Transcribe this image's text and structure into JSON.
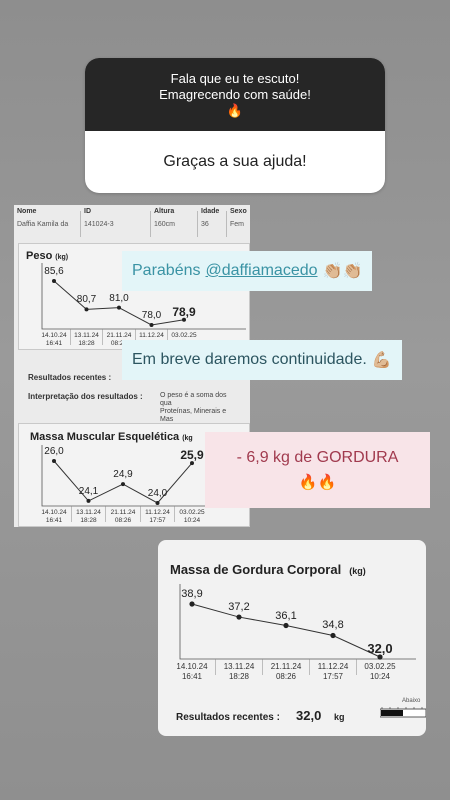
{
  "question_sticker": {
    "question_lines": [
      "Fala que eu te escuto!",
      "Emagrecendo com saúde!",
      "🔥"
    ],
    "answer": "Graças a sua ajuda!"
  },
  "report": {
    "header": [
      {
        "label": "Nome",
        "value": "Daffia Kamila da"
      },
      {
        "label": "ID",
        "value": "141024-3"
      },
      {
        "label": "Altura",
        "value": "160cm"
      },
      {
        "label": "Idade",
        "value": "36"
      },
      {
        "label": "Sexo",
        "value": "Fem"
      }
    ],
    "resultados_recentes": "Resultados recentes :",
    "interpretacao": "Interpretação dos resultados :",
    "interpretacao_texto": [
      "O peso é a soma dos qua",
      "Proteínas, Minerais e Mas"
    ]
  },
  "chart_data": [
    {
      "type": "line",
      "title": "Peso",
      "unit": "(kg)",
      "x": [
        "14.10.24 16:41",
        "13.11.24 18:28",
        "21.11.24 08:26",
        "11.12.24 17:57",
        "03.02.25 10:24"
      ],
      "values": [
        85.6,
        80.7,
        81.0,
        78.0,
        78.9
      ],
      "value_labels": [
        "85,6",
        "80,7",
        "81,0",
        "78,0",
        "78,9"
      ]
    },
    {
      "type": "line",
      "title": "Massa Muscular Esquelética",
      "unit": "(kg",
      "x": [
        "14.10.24 16:41",
        "13.11.24 18:28",
        "21.11.24 08:26",
        "11.12.24 17:57",
        "03.02.25 10:24"
      ],
      "values": [
        26.0,
        24.1,
        24.9,
        24.0,
        25.9
      ],
      "value_labels": [
        "26,0",
        "24,1",
        "24,9",
        "24,0",
        "25,9"
      ]
    },
    {
      "type": "line",
      "title": "Massa de Gordura Corporal",
      "unit": "(kg)",
      "x": [
        "14.10.24 16:41",
        "13.11.24 18:28",
        "21.11.24 08:26",
        "11.12.24 17:57",
        "03.02.25 10:24"
      ],
      "values": [
        38.9,
        37.2,
        36.1,
        34.8,
        32.0
      ],
      "value_labels": [
        "38,9",
        "37,2",
        "36,1",
        "34,8",
        "32,0"
      ]
    }
  ],
  "fat_photo": {
    "resultados_label": "Resultados recentes :",
    "resultados_value": "32,0",
    "resultados_unit": "kg",
    "scale_label": "Abaixo"
  },
  "stickers": {
    "congrats_text": "Parabéns",
    "congrats_mention": "@daffiamacedo",
    "congrats_emoji": "👏🏼👏🏼",
    "continuity_text": "Em breve daremos continuidade.",
    "continuity_emoji": "💪🏼",
    "fat_loss_text": "- 6,9 kg de GORDURA",
    "fat_loss_emoji": "🔥🔥"
  }
}
